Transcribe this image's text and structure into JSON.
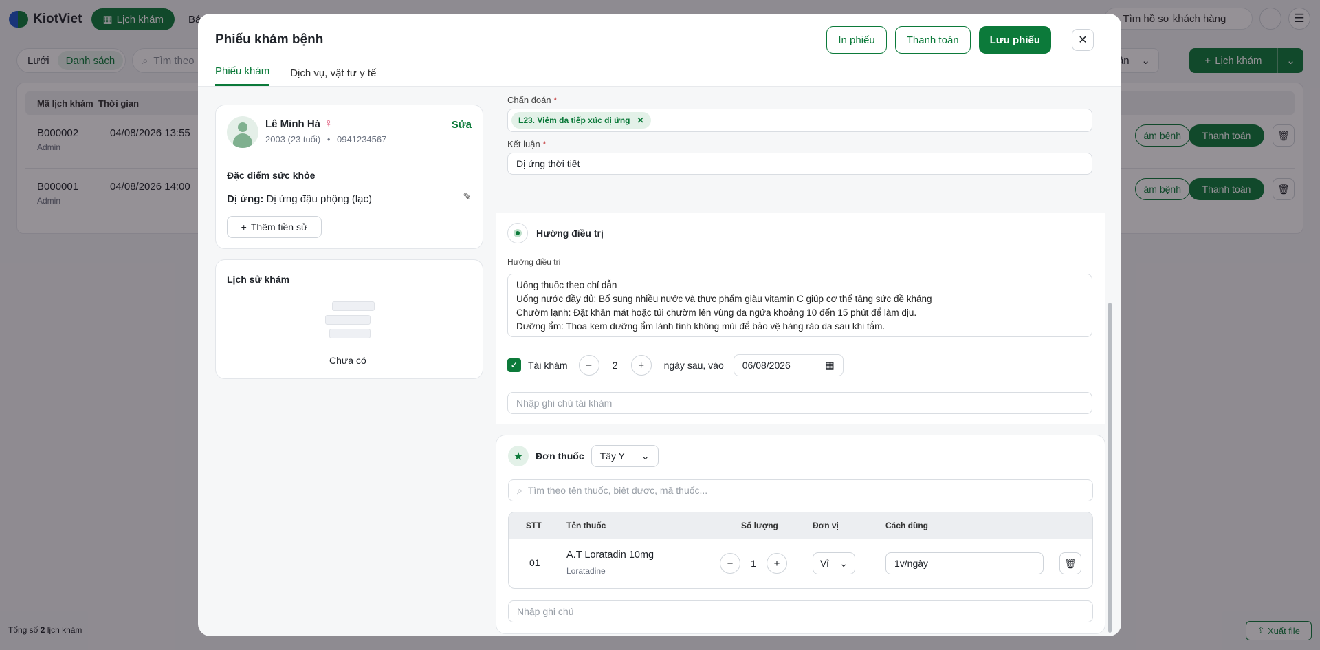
{
  "app": {
    "logo": "KiotViet",
    "nav_active": "Lịch khám",
    "nav_next": "Bán",
    "search_placeholder": "Tìm hồ sơ khách hàng"
  },
  "toolbar": {
    "view_grid": "Lưới",
    "view_list": "Danh sách",
    "search_placeholder": "Tìm theo",
    "period": "Tuần",
    "add_label": "Lịch khám"
  },
  "list": {
    "columns": [
      "Mã lịch khám",
      "Thời gian"
    ],
    "rows": [
      {
        "code": "B000002",
        "by": "Admin",
        "time": "04/08/2026 13:55",
        "exam_btn": "ám bệnh",
        "pay_btn": "Thanh toán"
      },
      {
        "code": "B000001",
        "by": "Admin",
        "time": "04/08/2026 14:00",
        "exam_btn": "ám bệnh",
        "pay_btn": "Thanh toán"
      }
    ],
    "total_prefix": "Tổng số",
    "total_count": "2",
    "total_suffix": "lịch khám",
    "export_label": "Xuất file"
  },
  "modal": {
    "title": "Phiếu khám bệnh",
    "print_btn": "In phiếu",
    "pay_btn": "Thanh toán",
    "save_btn": "Lưu phiếu",
    "tabs": [
      "Phiếu khám",
      "Dịch vụ, vật tư y tế"
    ]
  },
  "patient": {
    "name": "Lê Minh Hà",
    "birth": "2003 (23 tuổi)",
    "phone": "0941234567",
    "edit": "Sửa",
    "health_title": "Đặc điểm sức khỏe",
    "allergy_label": "Dị ứng:",
    "allergy_value": "Dị ứng đậu phộng (lạc)",
    "add_history": "Thêm tiền sử"
  },
  "history": {
    "title": "Lịch sử khám",
    "empty": "Chưa có"
  },
  "diagnosis": {
    "label": "Chẩn đoán",
    "chip": "L23. Viêm da tiếp xúc dị ứng"
  },
  "conclusion": {
    "label": "Kết luận",
    "value": "Dị ứng thời tiết"
  },
  "treatment": {
    "section_title": "Hướng điều trị",
    "field_label": "Hướng điều trị",
    "lines": [
      "Uống thuốc theo chỉ dẫn",
      "Uống nước đầy đủ: Bổ sung nhiều nước và thực phẩm giàu vitamin C giúp cơ thể tăng sức đề kháng",
      "Chườm lạnh: Đặt khăn mát hoặc túi chườm lên vùng da ngứa khoảng 10 đến 15 phút để làm dịu.",
      "Dưỡng ẩm: Thoa kem dưỡng ẩm lành tính không mùi để bảo vệ hàng rào da sau khi tắm."
    ],
    "recheck_label": "Tái khám",
    "recheck_days": "2",
    "after_label": "ngày sau, vào",
    "recheck_date": "06/08/2026",
    "note_placeholder": "Nhập ghi chú tái khám"
  },
  "prescription": {
    "title": "Đơn thuốc",
    "type": "Tây Y",
    "search_placeholder": "Tìm theo tên thuốc, biệt dược, mã thuốc...",
    "columns": [
      "STT",
      "Tên thuốc",
      "Số lượng",
      "Đơn vị",
      "Cách dùng"
    ],
    "items": [
      {
        "no": "01",
        "name": "A.T Loratadin 10mg",
        "generic": "Loratadine",
        "qty": "1",
        "unit": "Vỉ",
        "usage": "1v/ngày"
      }
    ],
    "note_placeholder": "Nhập ghi chú"
  },
  "colors": {
    "brand": "#0c7a3a",
    "brand_light": "#e3f1e8"
  }
}
